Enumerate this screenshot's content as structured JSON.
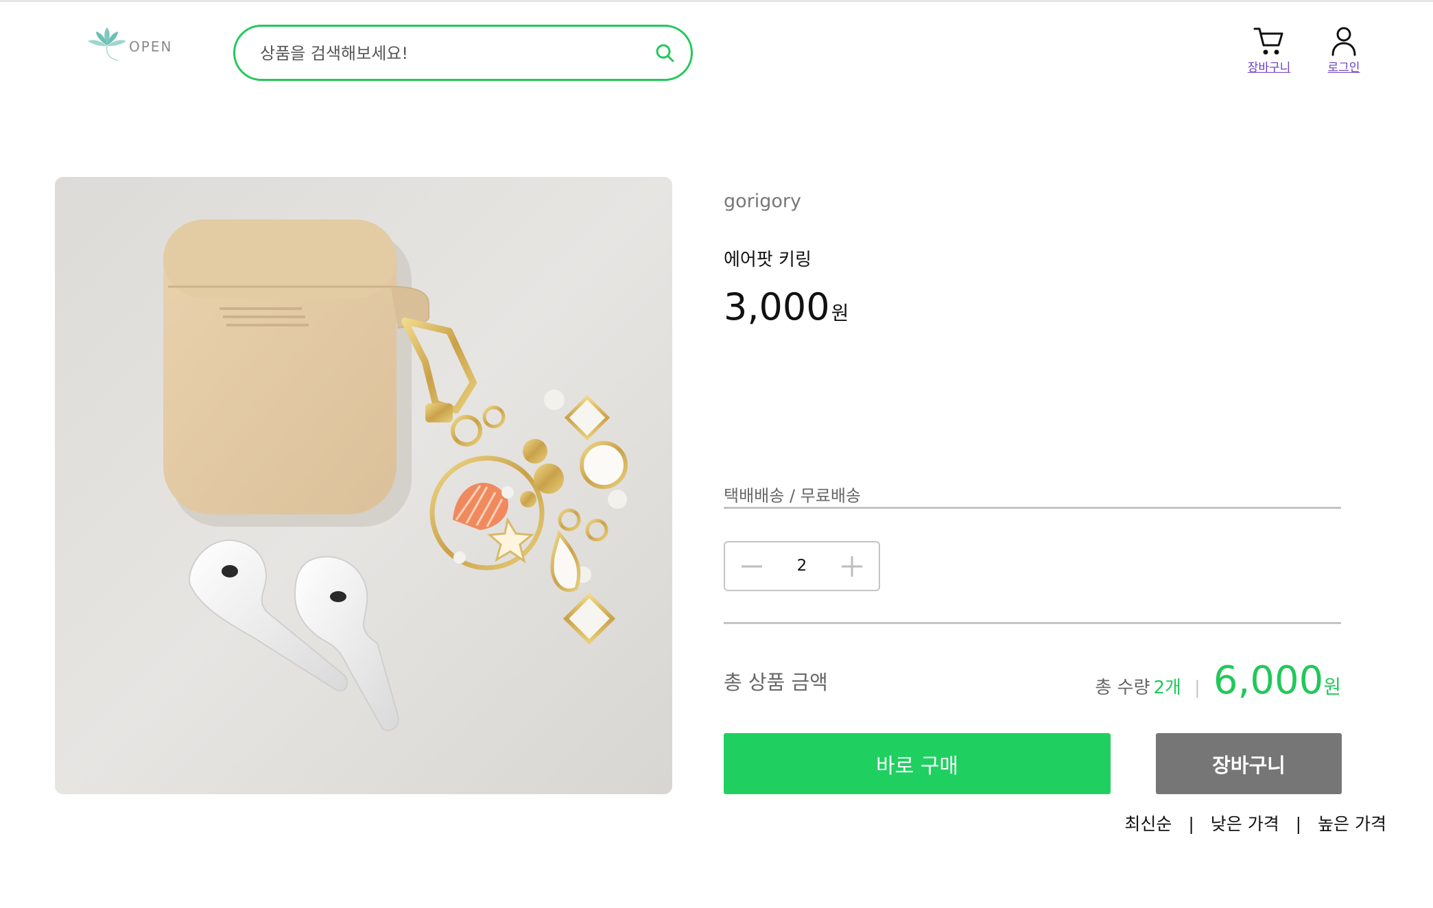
{
  "header": {
    "logo_text": "OPEN",
    "search_placeholder": "상품을 검색해보세요!",
    "cart_label": "장바구니",
    "login_label": "로그인"
  },
  "product": {
    "seller": "gorigory",
    "name": "에어팟 키링",
    "price": "3,000",
    "price_unit": "원",
    "shipping": "택배배송 / 무료배송",
    "quantity": "2"
  },
  "summary": {
    "total_label": "총 상품 금액",
    "total_qty_label": "총 수량",
    "total_qty_value": "2개",
    "separator": "|",
    "total_amount": "6,000",
    "total_unit": "원"
  },
  "actions": {
    "buy_now": "바로 구매",
    "add_to_cart": "장바구니"
  },
  "sort": {
    "latest": "최신순",
    "low_price": "낮은 가격",
    "high_price": "높은 가격",
    "separator": "|"
  },
  "colors": {
    "accent": "#21c85a",
    "buy_button": "#1fd060",
    "cart_button": "#767676",
    "nav_link": "#6b3ec9"
  },
  "icons": {
    "search": "search-icon",
    "cart": "cart-icon",
    "user": "user-icon",
    "minus": "minus-icon",
    "plus": "plus-icon"
  }
}
